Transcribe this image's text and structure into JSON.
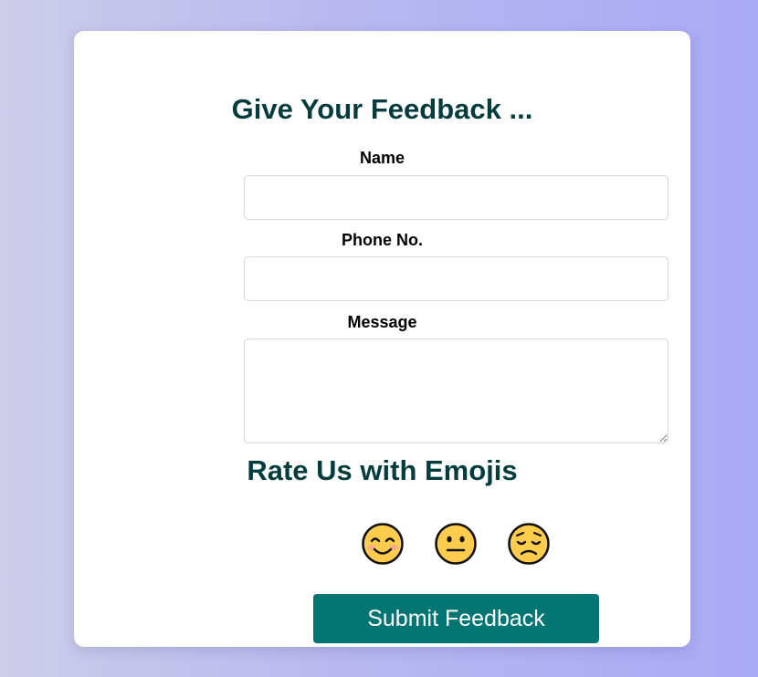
{
  "form": {
    "title": "Give Your Feedback ...",
    "fields": {
      "name": {
        "label": "Name",
        "value": "",
        "placeholder": ""
      },
      "phone": {
        "label": "Phone No.",
        "value": "",
        "placeholder": ""
      },
      "message": {
        "label": "Message",
        "value": "",
        "placeholder": ""
      }
    },
    "rating": {
      "title": "Rate Us with Emojis",
      "options": [
        {
          "icon": "smiling-face-icon",
          "mood": "happy"
        },
        {
          "icon": "neutral-face-icon",
          "mood": "neutral"
        },
        {
          "icon": "pensive-face-icon",
          "mood": "sad"
        }
      ]
    },
    "submit_label": "Submit Feedback"
  },
  "colors": {
    "heading": "#053d3f",
    "button": "#037674",
    "background_left": "#cdcdea",
    "background_right": "#a9aaf5",
    "emoji_face": "#ffcc4d"
  }
}
